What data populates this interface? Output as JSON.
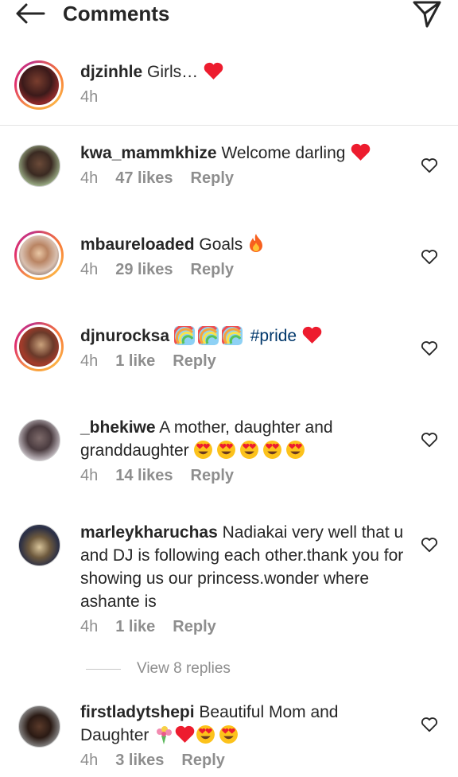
{
  "header": {
    "title": "Comments",
    "back_icon": "arrow-left-icon",
    "send_icon": "paper-plane-icon"
  },
  "caption": {
    "username": "djzinhle",
    "text": "Girls…",
    "emoji": "red-heart",
    "time": "4h"
  },
  "comments": [
    {
      "username": "kwa_mammkhize",
      "text": "Welcome darling",
      "emoji": [
        "red-heart"
      ],
      "time": "4h",
      "likes": "47 likes",
      "reply": "Reply"
    },
    {
      "username": "mbaureloaded",
      "text": "Goals",
      "emoji": [
        "fire"
      ],
      "time": "4h",
      "likes": "29 likes",
      "reply": "Reply"
    },
    {
      "username": "djnurocksa",
      "text": "",
      "hashtag": "#pride",
      "emoji": [
        "rainbow",
        "rainbow",
        "rainbow",
        "red-heart"
      ],
      "time": "4h",
      "likes": "1 like",
      "reply": "Reply"
    },
    {
      "username": "_bhekiwe",
      "text": "A mother, daughter  and granddaughter",
      "emoji": [
        "heart-eyes",
        "heart-eyes",
        "heart-eyes",
        "heart-eyes",
        "heart-eyes"
      ],
      "time": "4h",
      "likes": "14 likes",
      "reply": "Reply"
    },
    {
      "username": "marleykharuchas",
      "text": "Nadiakai very well that u and DJ is following  each other.thank you for showing us our princess.wonder where ashante  is",
      "emoji": [],
      "time": "4h",
      "likes": "1 like",
      "reply": "Reply"
    },
    {
      "username": "firstladytshepi",
      "text": "Beautiful Mom and Daughter",
      "emoji": [
        "bouquet",
        "red-heart",
        "heart-eyes",
        "heart-eyes"
      ],
      "time": "4h",
      "likes": "3 likes",
      "reply": "Reply"
    }
  ],
  "view_replies": "View 8 replies",
  "colors": {
    "text": "#262626",
    "meta": "#8e8e8e",
    "hashtag": "#00376b",
    "heart": "#ed1c2e",
    "divider": "#e3e3e3"
  }
}
